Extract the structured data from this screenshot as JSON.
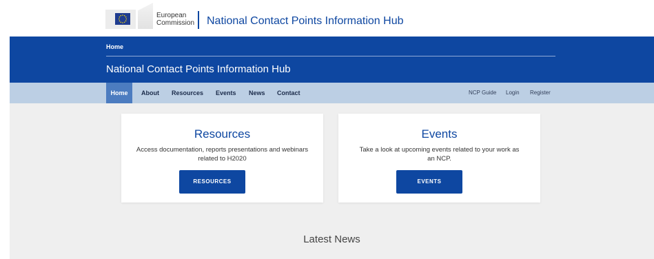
{
  "header": {
    "logo_line1": "European",
    "logo_line2": "Commission",
    "site_title": "National Contact Points Information Hub"
  },
  "breadcrumb": {
    "home": "Home"
  },
  "band": {
    "title": "National Contact Points Information Hub"
  },
  "nav": {
    "items": [
      {
        "label": "Home",
        "active": true
      },
      {
        "label": "About"
      },
      {
        "label": "Resources"
      },
      {
        "label": "Events"
      },
      {
        "label": "News"
      },
      {
        "label": "Contact"
      }
    ],
    "right_items": [
      {
        "label": "NCP Guide"
      },
      {
        "label": "Login"
      },
      {
        "label": "Register"
      }
    ]
  },
  "cards": [
    {
      "title": "Resources",
      "description": "Access documentation, reports presentations and webinars related to H2020",
      "button": "RESOURCES"
    },
    {
      "title": "Events",
      "description": "Take a look at upcoming events related to your work as an NCP.",
      "button": "EVENTS"
    }
  ],
  "latest_news": {
    "heading": "Latest News"
  },
  "colors": {
    "primary": "#0e47a1",
    "nav_bg": "#bccfe4",
    "nav_active": "#4c7cc0",
    "content_bg": "#efefef"
  }
}
